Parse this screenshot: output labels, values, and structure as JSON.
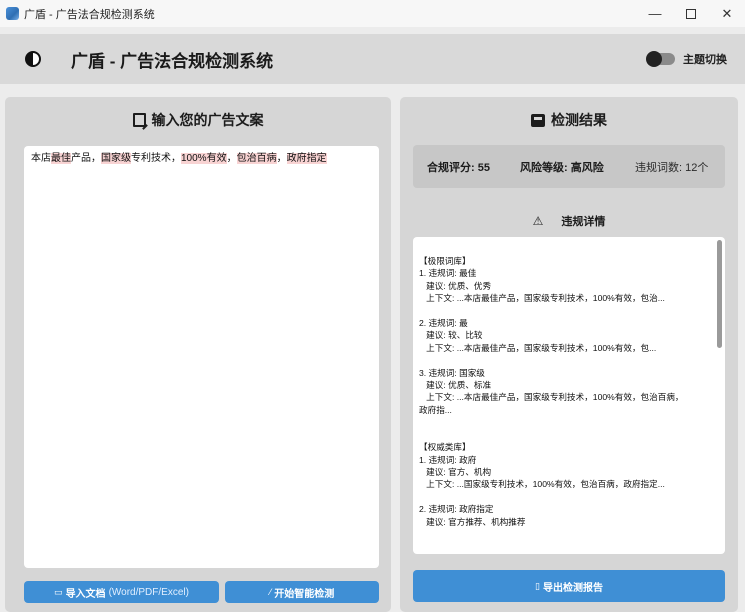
{
  "window": {
    "title": "广盾 - 广告法合规检测系统",
    "controls": {
      "minimize": "—",
      "close": "✕"
    }
  },
  "header": {
    "title": "广盾 - 广告法合规检测系统",
    "theme_toggle_label": "主题切换",
    "theme_dark": true
  },
  "input_panel": {
    "title": "输入您的广告文案",
    "segments": [
      {
        "text": "本店",
        "flag": false
      },
      {
        "text": "最佳",
        "flag": true
      },
      {
        "text": "产品，",
        "flag": false
      },
      {
        "text": "国家级",
        "flag": true
      },
      {
        "text": "专利技术，",
        "flag": false
      },
      {
        "text": "100%有效",
        "flag": true
      },
      {
        "text": "，",
        "flag": false
      },
      {
        "text": "包治百病",
        "flag": true
      },
      {
        "text": "，",
        "flag": false
      },
      {
        "text": "政府指定",
        "flag": true
      }
    ],
    "import_button": {
      "label": "导入文档",
      "sub": "(Word/PDF/Excel)"
    },
    "detect_button": {
      "label": "开始智能检测"
    }
  },
  "result_panel": {
    "title": "检测结果",
    "score": "合规评分: 55",
    "risk": "风险等级: 高风险",
    "count": "违规词数: 12个",
    "details_title": "违规详情",
    "details": "【极限词库】\n1. 违规词: 最佳\n   建议: 优质、优秀\n   上下文: ...本店最佳产品，国家级专利技术，100%有效，包治...\n\n2. 违规词: 最\n   建议: 较、比较\n   上下文: ...本店最佳产品，国家级专利技术，100%有效，包...\n\n3. 违规词: 国家级\n   建议: 优质、标准\n   上下文: ...本店最佳产品，国家级专利技术，100%有效，包治百病，\n政府指...\n\n\n【权威类库】\n1. 违规词: 政府\n   建议: 官方、机构\n   上下文: ...国家级专利技术，100%有效，包治百病，政府指定...\n\n2. 违规词: 政府指定\n   建议: 官方推荐、机构推荐",
    "export_button": {
      "label": "导出检测报告"
    }
  },
  "colors": {
    "accent": "#3f8fd5",
    "highlight": "#f8d3d3",
    "panel": "#d6d6d6"
  }
}
